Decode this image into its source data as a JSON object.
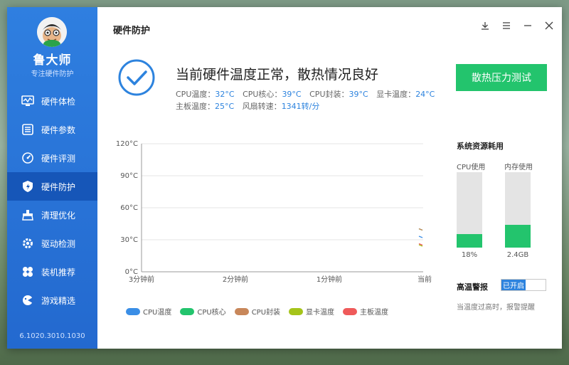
{
  "app": {
    "brand": "鲁大师",
    "slogan": "专注硬件防护",
    "version": "6.1020.3010.1030",
    "page_title": "硬件防护"
  },
  "sidebar": {
    "items": [
      {
        "label": "硬件体检",
        "icon": "monitor-icon"
      },
      {
        "label": "硬件参数",
        "icon": "list-icon"
      },
      {
        "label": "硬件评测",
        "icon": "speedometer-icon"
      },
      {
        "label": "硬件防护",
        "icon": "shield-icon",
        "active": true
      },
      {
        "label": "清理优化",
        "icon": "broom-icon"
      },
      {
        "label": "驱动检测",
        "icon": "gear-icon"
      },
      {
        "label": "装机推荐",
        "icon": "fan-icon"
      },
      {
        "label": "游戏精选",
        "icon": "gamepad-icon"
      }
    ]
  },
  "status": {
    "headline": "当前硬件温度正常，散热情况良好",
    "line1": [
      {
        "label": "CPU温度：",
        "value": "32°C"
      },
      {
        "label": "CPU核心：",
        "value": "39°C"
      },
      {
        "label": "CPU封装：",
        "value": "39°C"
      },
      {
        "label": "显卡温度：",
        "value": "24°C"
      }
    ],
    "line2": [
      {
        "label": "主板温度：",
        "value": "25°C"
      },
      {
        "label": "风扇转速：",
        "value": "1341转/分"
      }
    ]
  },
  "stress_button": "散热压力测试",
  "chart_data": {
    "type": "line",
    "y_ticks": [
      "120°C",
      "90°C",
      "60°C",
      "30°C",
      "0°C"
    ],
    "ylim": [
      0,
      120
    ],
    "x_ticks": [
      "3分钟前",
      "2分钟前",
      "1分钟前",
      "当前"
    ],
    "series": [
      {
        "name": "CPU温度",
        "color": "#3a8ee6",
        "values": [
          32
        ]
      },
      {
        "name": "CPU核心",
        "color": "#23c46d",
        "values": [
          39
        ]
      },
      {
        "name": "CPU封装",
        "color": "#c8875a",
        "values": [
          39
        ]
      },
      {
        "name": "显卡温度",
        "color": "#a5c41a",
        "values": [
          24
        ]
      },
      {
        "name": "主板温度",
        "color": "#ef5a5a",
        "values": [
          25
        ]
      }
    ]
  },
  "resources": {
    "title": "系统资源耗用",
    "cpu": {
      "label": "CPU使用",
      "value": "18%",
      "fraction": 0.18
    },
    "mem": {
      "label": "内存使用",
      "value": "2.4GB",
      "fraction": 0.3
    }
  },
  "alarm": {
    "label": "高温警报",
    "toggle_on": "已开启",
    "note": "当温度过高时，报警提醒"
  }
}
